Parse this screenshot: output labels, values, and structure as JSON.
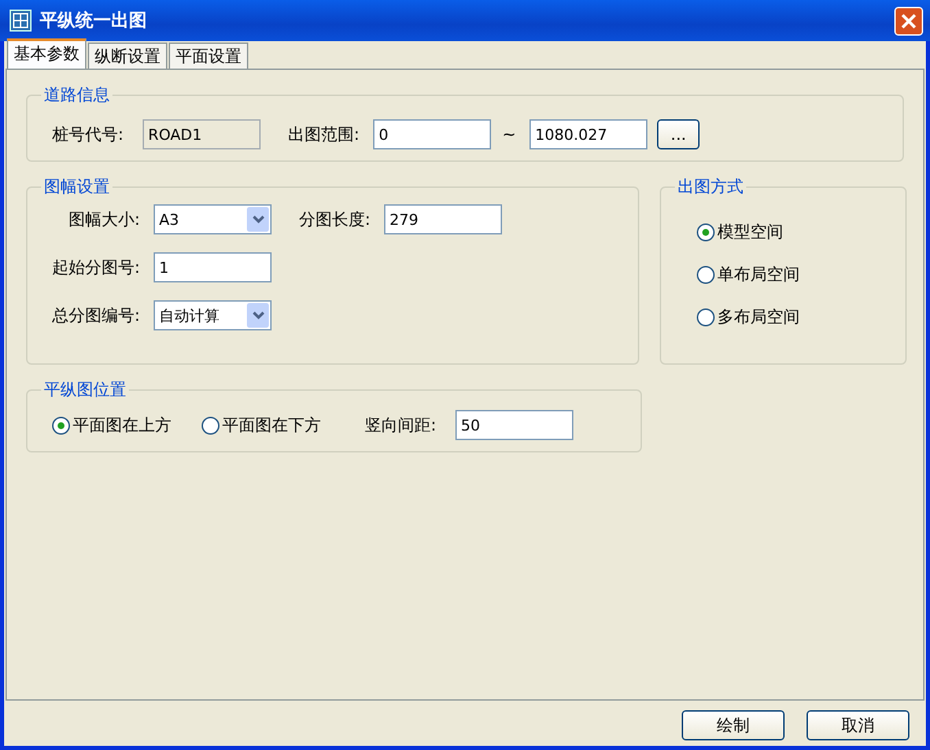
{
  "window": {
    "title": "平纵统一出图"
  },
  "tabs": [
    {
      "label": "基本参数",
      "selected": true
    },
    {
      "label": "纵断设置",
      "selected": false
    },
    {
      "label": "平面设置",
      "selected": false
    }
  ],
  "road_info": {
    "title": "道路信息",
    "station_label": "桩号代号:",
    "station_value": "ROAD1",
    "station_disabled": true,
    "range_label": "出图范围:",
    "range_from": "0",
    "range_sep": "~",
    "range_to": "1080.027",
    "browse_button": "..."
  },
  "sheet_settings": {
    "title": "图幅设置",
    "rows": [
      [
        {
          "kind": "dropdown",
          "label": "图幅大小:",
          "value": "A3"
        },
        {
          "kind": "text",
          "label": "分图长度:",
          "value": "279"
        }
      ],
      [
        {
          "kind": "text",
          "label": "起始分图号:",
          "value": "1"
        }
      ],
      [
        {
          "kind": "dropdown",
          "label": "总分图编号:",
          "value": "自动计算"
        }
      ]
    ]
  },
  "output_mode": {
    "title": "出图方式",
    "options": [
      {
        "label": "模型空间",
        "selected": true
      },
      {
        "label": "单布局空间",
        "selected": false
      },
      {
        "label": "多布局空间",
        "selected": false
      }
    ]
  },
  "plan_profile_position": {
    "title": "平纵图位置",
    "options": [
      {
        "label": "平面图在上方",
        "selected": true
      },
      {
        "label": "平面图在下方",
        "selected": false
      }
    ],
    "spacing_label": "竖向间距:",
    "spacing_value": "50"
  },
  "buttons": [
    {
      "label": "绘制"
    },
    {
      "label": "取消"
    }
  ]
}
